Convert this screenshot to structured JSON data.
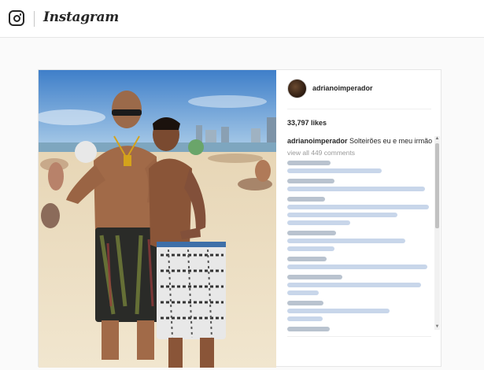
{
  "app": {
    "logo_icon": "instagram-camera-icon",
    "wordmark": "Instagram"
  },
  "post": {
    "username": "adrianoimperador",
    "likes": "33,797 likes",
    "caption": {
      "username": "adrianoimperador",
      "text": "Solteirões eu e meu irmão"
    },
    "view_all_comments": "view all 449 comments",
    "comment_count_visible": 11
  },
  "colors": {
    "accent": "#262626",
    "muted": "#999999",
    "border": "#e6e6e6",
    "background": "#fafafa"
  }
}
